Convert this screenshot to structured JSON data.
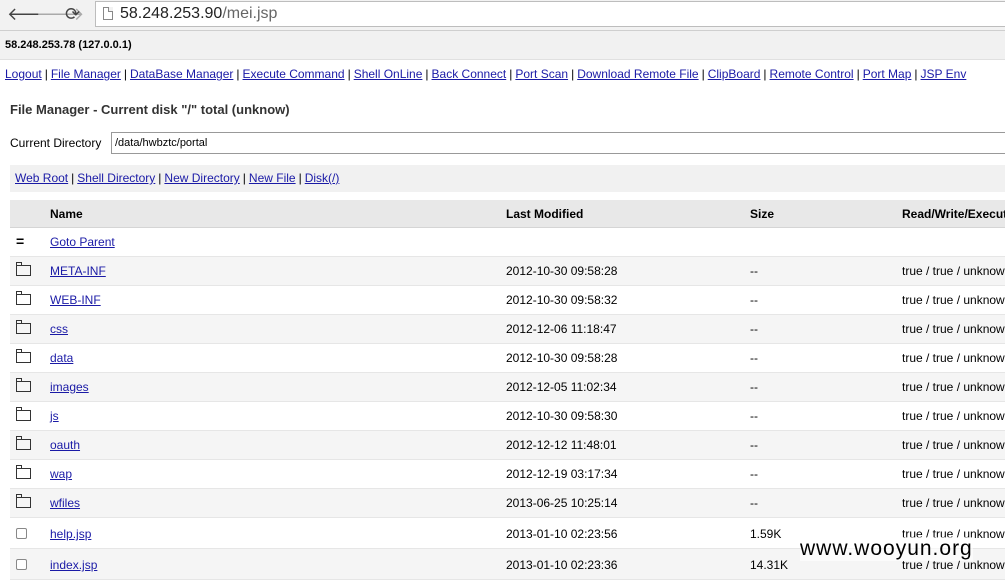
{
  "browser": {
    "back": "🡐",
    "forward": "🡒",
    "reload": "⟳",
    "url_host": "58.248.253.90",
    "url_path": "/mei.jsp"
  },
  "host_info": "58.248.253.78 (127.0.0.1)",
  "top_links": [
    "Logout",
    "File Manager",
    "DataBase Manager",
    "Execute Command",
    "Shell OnLine",
    "Back Connect",
    "Port Scan",
    "Download Remote File",
    "ClipBoard",
    "Remote Control",
    "Port Map",
    "JSP Env"
  ],
  "title": "File Manager - Current disk \"/\" total (unknow)",
  "current_directory": {
    "label": "Current Directory",
    "value": "/data/hwbztc/portal"
  },
  "dir_links": [
    "Web Root",
    "Shell Directory",
    "New Directory",
    "New File",
    "Disk(/)"
  ],
  "table": {
    "headers": {
      "name": "Name",
      "modified": "Last Modified",
      "size": "Size",
      "rwx": "Read/Write/Execute"
    },
    "parent": {
      "icon": "=",
      "label": "Goto Parent"
    },
    "rows": [
      {
        "type": "folder",
        "name": "META-INF",
        "modified": "2012-10-30 09:58:28",
        "size": "--",
        "rwx": "true / true / unknow"
      },
      {
        "type": "folder",
        "name": "WEB-INF",
        "modified": "2012-10-30 09:58:32",
        "size": "--",
        "rwx": "true / true / unknow"
      },
      {
        "type": "folder",
        "name": "css",
        "modified": "2012-12-06 11:18:47",
        "size": "--",
        "rwx": "true / true / unknow"
      },
      {
        "type": "folder",
        "name": "data",
        "modified": "2012-10-30 09:58:28",
        "size": "--",
        "rwx": "true / true / unknow"
      },
      {
        "type": "folder",
        "name": "images",
        "modified": "2012-12-05 11:02:34",
        "size": "--",
        "rwx": "true / true / unknow"
      },
      {
        "type": "folder",
        "name": "js",
        "modified": "2012-10-30 09:58:30",
        "size": "--",
        "rwx": "true / true / unknow"
      },
      {
        "type": "folder",
        "name": "oauth",
        "modified": "2012-12-12 11:48:01",
        "size": "--",
        "rwx": "true / true / unknow"
      },
      {
        "type": "folder",
        "name": "wap",
        "modified": "2012-12-19 03:17:34",
        "size": "--",
        "rwx": "true / true / unknow"
      },
      {
        "type": "folder",
        "name": "wfiles",
        "modified": "2013-06-25 10:25:14",
        "size": "--",
        "rwx": "true / true / unknow"
      },
      {
        "type": "file",
        "name": "help.jsp",
        "modified": "2013-01-10 02:23:56",
        "size": "1.59K",
        "rwx": "true / true / unknow"
      },
      {
        "type": "file",
        "name": "index.jsp",
        "modified": "2013-01-10 02:23:36",
        "size": "14.31K",
        "rwx": "true / true / unknow"
      }
    ]
  },
  "watermark": "www.wooyun.org"
}
